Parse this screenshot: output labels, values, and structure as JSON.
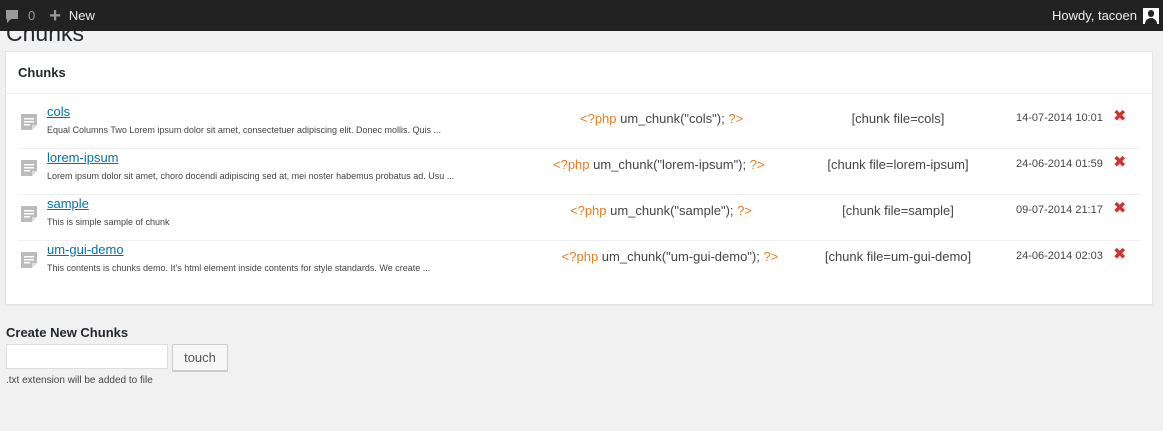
{
  "adminbar": {
    "comment_count": "0",
    "new_label": "New",
    "howdy": "Howdy, tacoen"
  },
  "page": {
    "title": "Chunks"
  },
  "postbox": {
    "heading": "Chunks",
    "rows": [
      {
        "title": "cols",
        "excerpt": "Equal Columns Two Lorem ipsum dolor sit amet, consectetuer adipiscing elit. Donec mollis. Quis ...",
        "php_open": "<?php",
        "code": " um_chunk(\"cols\"); ",
        "php_close": "?>",
        "shortcode": "[chunk file=cols]",
        "date": "14-07-2014 10:01"
      },
      {
        "title": "lorem-ipsum",
        "excerpt": "Lorem ipsum dolor sit amet, choro docendi adipiscing sed at, mei noster habemus probatus ad. Usu ...",
        "php_open": "<?php",
        "code": " um_chunk(\"lorem-ipsum\"); ",
        "php_close": "?>",
        "shortcode": "[chunk file=lorem-ipsum]",
        "date": "24-06-2014 01:59"
      },
      {
        "title": "sample",
        "excerpt": "This is simple sample of chunk",
        "php_open": "<?php",
        "code": " um_chunk(\"sample\"); ",
        "php_close": "?>",
        "shortcode": "[chunk file=sample]",
        "date": "09-07-2014 21:17"
      },
      {
        "title": "um-gui-demo",
        "excerpt": "This contents is chunks demo. It's html element inside contents for style standards. We create ...",
        "php_open": "<?php",
        "code": " um_chunk(\"um-gui-demo\"); ",
        "php_close": "?>",
        "shortcode": "[chunk file=um-gui-demo]",
        "date": "24-06-2014 02:03"
      }
    ],
    "delete_glyph": "✖"
  },
  "create": {
    "title": "Create New Chunks",
    "input_value": "",
    "button_label": "touch",
    "hint": ".txt extension will be added to file"
  },
  "colors": {
    "adminbar_bg": "#222222",
    "link": "#0073aa",
    "php_tag": "#e67e22",
    "delete": "#cc3333",
    "page_bg": "#f1f1f1"
  }
}
